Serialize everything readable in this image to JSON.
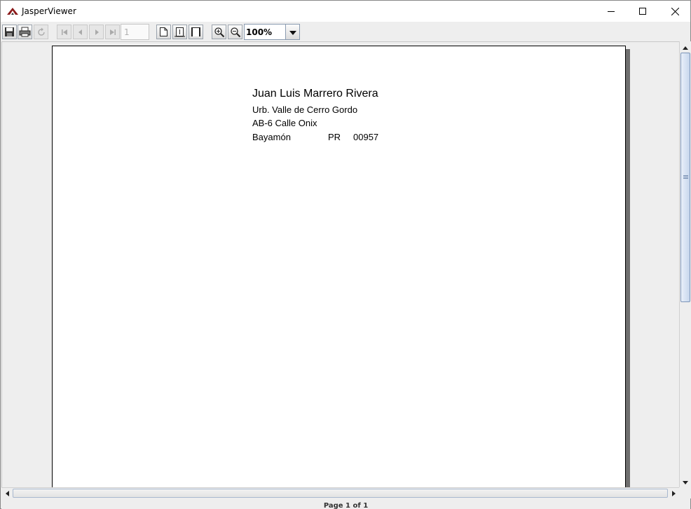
{
  "window": {
    "title": "JasperViewer",
    "controls": {
      "minimize": "minimize-icon",
      "maximize": "maximize-icon",
      "close": "close-icon"
    }
  },
  "toolbar": {
    "buttons": [
      {
        "name": "save",
        "icon": "floppy-disk-icon",
        "enabled": true
      },
      {
        "name": "print",
        "icon": "printer-icon",
        "enabled": true
      },
      {
        "name": "reload",
        "icon": "refresh-icon",
        "enabled": false
      },
      {
        "name": "first-page",
        "icon": "first-page-icon",
        "enabled": false
      },
      {
        "name": "previous-page",
        "icon": "previous-page-icon",
        "enabled": false
      },
      {
        "name": "next-page",
        "icon": "next-page-icon",
        "enabled": false
      },
      {
        "name": "last-page",
        "icon": "last-page-icon",
        "enabled": false
      },
      {
        "name": "actual-size",
        "icon": "actual-size-icon",
        "enabled": true
      },
      {
        "name": "fit-page",
        "icon": "fit-page-icon",
        "enabled": true
      },
      {
        "name": "fit-width",
        "icon": "fit-width-icon",
        "enabled": true
      },
      {
        "name": "zoom-in",
        "icon": "zoom-in-icon",
        "enabled": true
      },
      {
        "name": "zoom-out",
        "icon": "zoom-out-icon",
        "enabled": true
      }
    ],
    "page_number": "1",
    "zoom": "100%"
  },
  "report": {
    "name": "Juan Luis Marrero Rivera",
    "line1": "Urb. Valle de Cerro Gordo",
    "line2": "AB-6 Calle Onix",
    "city": "Bayamón",
    "state": "PR",
    "zip": "00957"
  },
  "status": {
    "text": "Page 1 of 1"
  },
  "colors": {
    "window_bg": "#eeeeee",
    "page_bg": "#ffffff",
    "page_shadow": "#6f6f6f",
    "scroll_thumb": "#c7d6ec"
  }
}
